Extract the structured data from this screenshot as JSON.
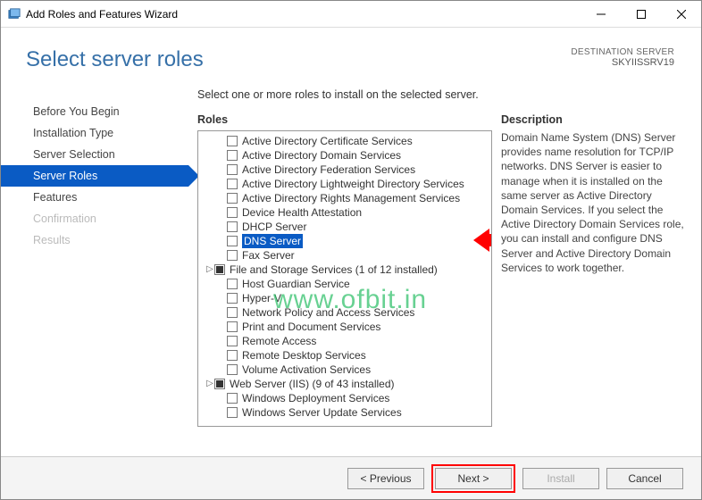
{
  "titlebar": {
    "title": "Add Roles and Features Wizard"
  },
  "header": {
    "page_title": "Select server roles",
    "dest_label": "DESTINATION SERVER",
    "dest_server": "SKYIISSRV19"
  },
  "steps": [
    {
      "label": "Before You Begin",
      "state": "normal"
    },
    {
      "label": "Installation Type",
      "state": "normal"
    },
    {
      "label": "Server Selection",
      "state": "normal"
    },
    {
      "label": "Server Roles",
      "state": "current"
    },
    {
      "label": "Features",
      "state": "normal"
    },
    {
      "label": "Confirmation",
      "state": "disabled"
    },
    {
      "label": "Results",
      "state": "disabled"
    }
  ],
  "main": {
    "instruction": "Select one or more roles to install on the selected server.",
    "roles_heading": "Roles",
    "roles": [
      {
        "label": "Active Directory Certificate Services",
        "checked": false,
        "indent": 1
      },
      {
        "label": "Active Directory Domain Services",
        "checked": false,
        "indent": 1
      },
      {
        "label": "Active Directory Federation Services",
        "checked": false,
        "indent": 1
      },
      {
        "label": "Active Directory Lightweight Directory Services",
        "checked": false,
        "indent": 1
      },
      {
        "label": "Active Directory Rights Management Services",
        "checked": false,
        "indent": 1
      },
      {
        "label": "Device Health Attestation",
        "checked": false,
        "indent": 1
      },
      {
        "label": "DHCP Server",
        "checked": false,
        "indent": 1
      },
      {
        "label": "DNS Server",
        "checked": false,
        "indent": 1,
        "selected": true
      },
      {
        "label": "Fax Server",
        "checked": false,
        "indent": 1
      },
      {
        "label": "File and Storage Services (1 of 12 installed)",
        "checked": "filled",
        "indent": 0,
        "expandable": true
      },
      {
        "label": "Host Guardian Service",
        "checked": false,
        "indent": 1
      },
      {
        "label": "Hyper-V",
        "checked": false,
        "indent": 1
      },
      {
        "label": "Network Policy and Access Services",
        "checked": false,
        "indent": 1
      },
      {
        "label": "Print and Document Services",
        "checked": false,
        "indent": 1
      },
      {
        "label": "Remote Access",
        "checked": false,
        "indent": 1
      },
      {
        "label": "Remote Desktop Services",
        "checked": false,
        "indent": 1
      },
      {
        "label": "Volume Activation Services",
        "checked": false,
        "indent": 1
      },
      {
        "label": "Web Server (IIS) (9 of 43 installed)",
        "checked": "filled",
        "indent": 0,
        "expandable": true
      },
      {
        "label": "Windows Deployment Services",
        "checked": false,
        "indent": 1
      },
      {
        "label": "Windows Server Update Services",
        "checked": false,
        "indent": 1
      }
    ],
    "desc_heading": "Description",
    "desc_text": "Domain Name System (DNS) Server provides name resolution for TCP/IP networks. DNS Server is easier to manage when it is installed on the same server as Active Directory Domain Services. If you select the Active Directory Domain Services role, you can install and configure DNS Server and Active Directory Domain Services to work together."
  },
  "footer": {
    "prev": "< Previous",
    "next": "Next >",
    "install": "Install",
    "cancel": "Cancel"
  },
  "watermark": "www.ofbit.in"
}
